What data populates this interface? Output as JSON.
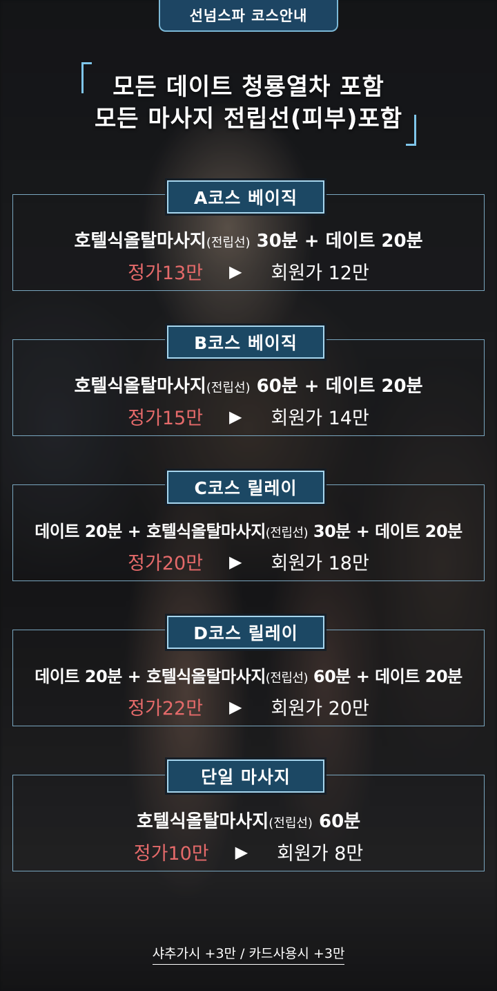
{
  "header": {
    "title": "선넘스파 코스안내"
  },
  "headline": {
    "line1": "모든 데이트 청룡열차 포함",
    "line2": "모든 마사지 전립선(피부)포함"
  },
  "courses": [
    {
      "badge": "A코스 베이직",
      "desc_a": "호텔식올탈마사지",
      "desc_paren": "(전립선)",
      "desc_b": " 30분 + 데이트 20분",
      "regular_price": "정가13만",
      "arrow": "▶",
      "member_price": "회원가 12만"
    },
    {
      "badge": "B코스 베이직",
      "desc_a": "호텔식올탈마사지",
      "desc_paren": "(전립선)",
      "desc_b": " 60분 + 데이트 20분",
      "regular_price": "정가15만",
      "arrow": "▶",
      "member_price": "회원가 14만"
    },
    {
      "badge": "C코스 릴레이",
      "desc_a": "데이트 20분 + 호텔식올탈마사지",
      "desc_paren": "(전립선)",
      "desc_b": " 30분 + 데이트 20분",
      "regular_price": "정가20만",
      "arrow": "▶",
      "member_price": "회원가 18만"
    },
    {
      "badge": "D코스 릴레이",
      "desc_a": "데이트 20분 + 호텔식올탈마사지",
      "desc_paren": "(전립선)",
      "desc_b": " 60분 + 데이트 20분",
      "regular_price": "정가22만",
      "arrow": "▶",
      "member_price": "회원가 20만"
    },
    {
      "badge": "단일 마사지",
      "desc_a": "호텔식올탈마사지",
      "desc_paren": "(전립선)",
      "desc_b": " 60분",
      "regular_price": "정가10만",
      "arrow": "▶",
      "member_price": "회원가 8만"
    }
  ],
  "footer": {
    "note": "샤추가시 +3만 / 카드사용시 +3만"
  },
  "colors": {
    "accent": "#7fc6ea",
    "badge_bg": "#1c4864",
    "price_red": "#e56a6a"
  }
}
